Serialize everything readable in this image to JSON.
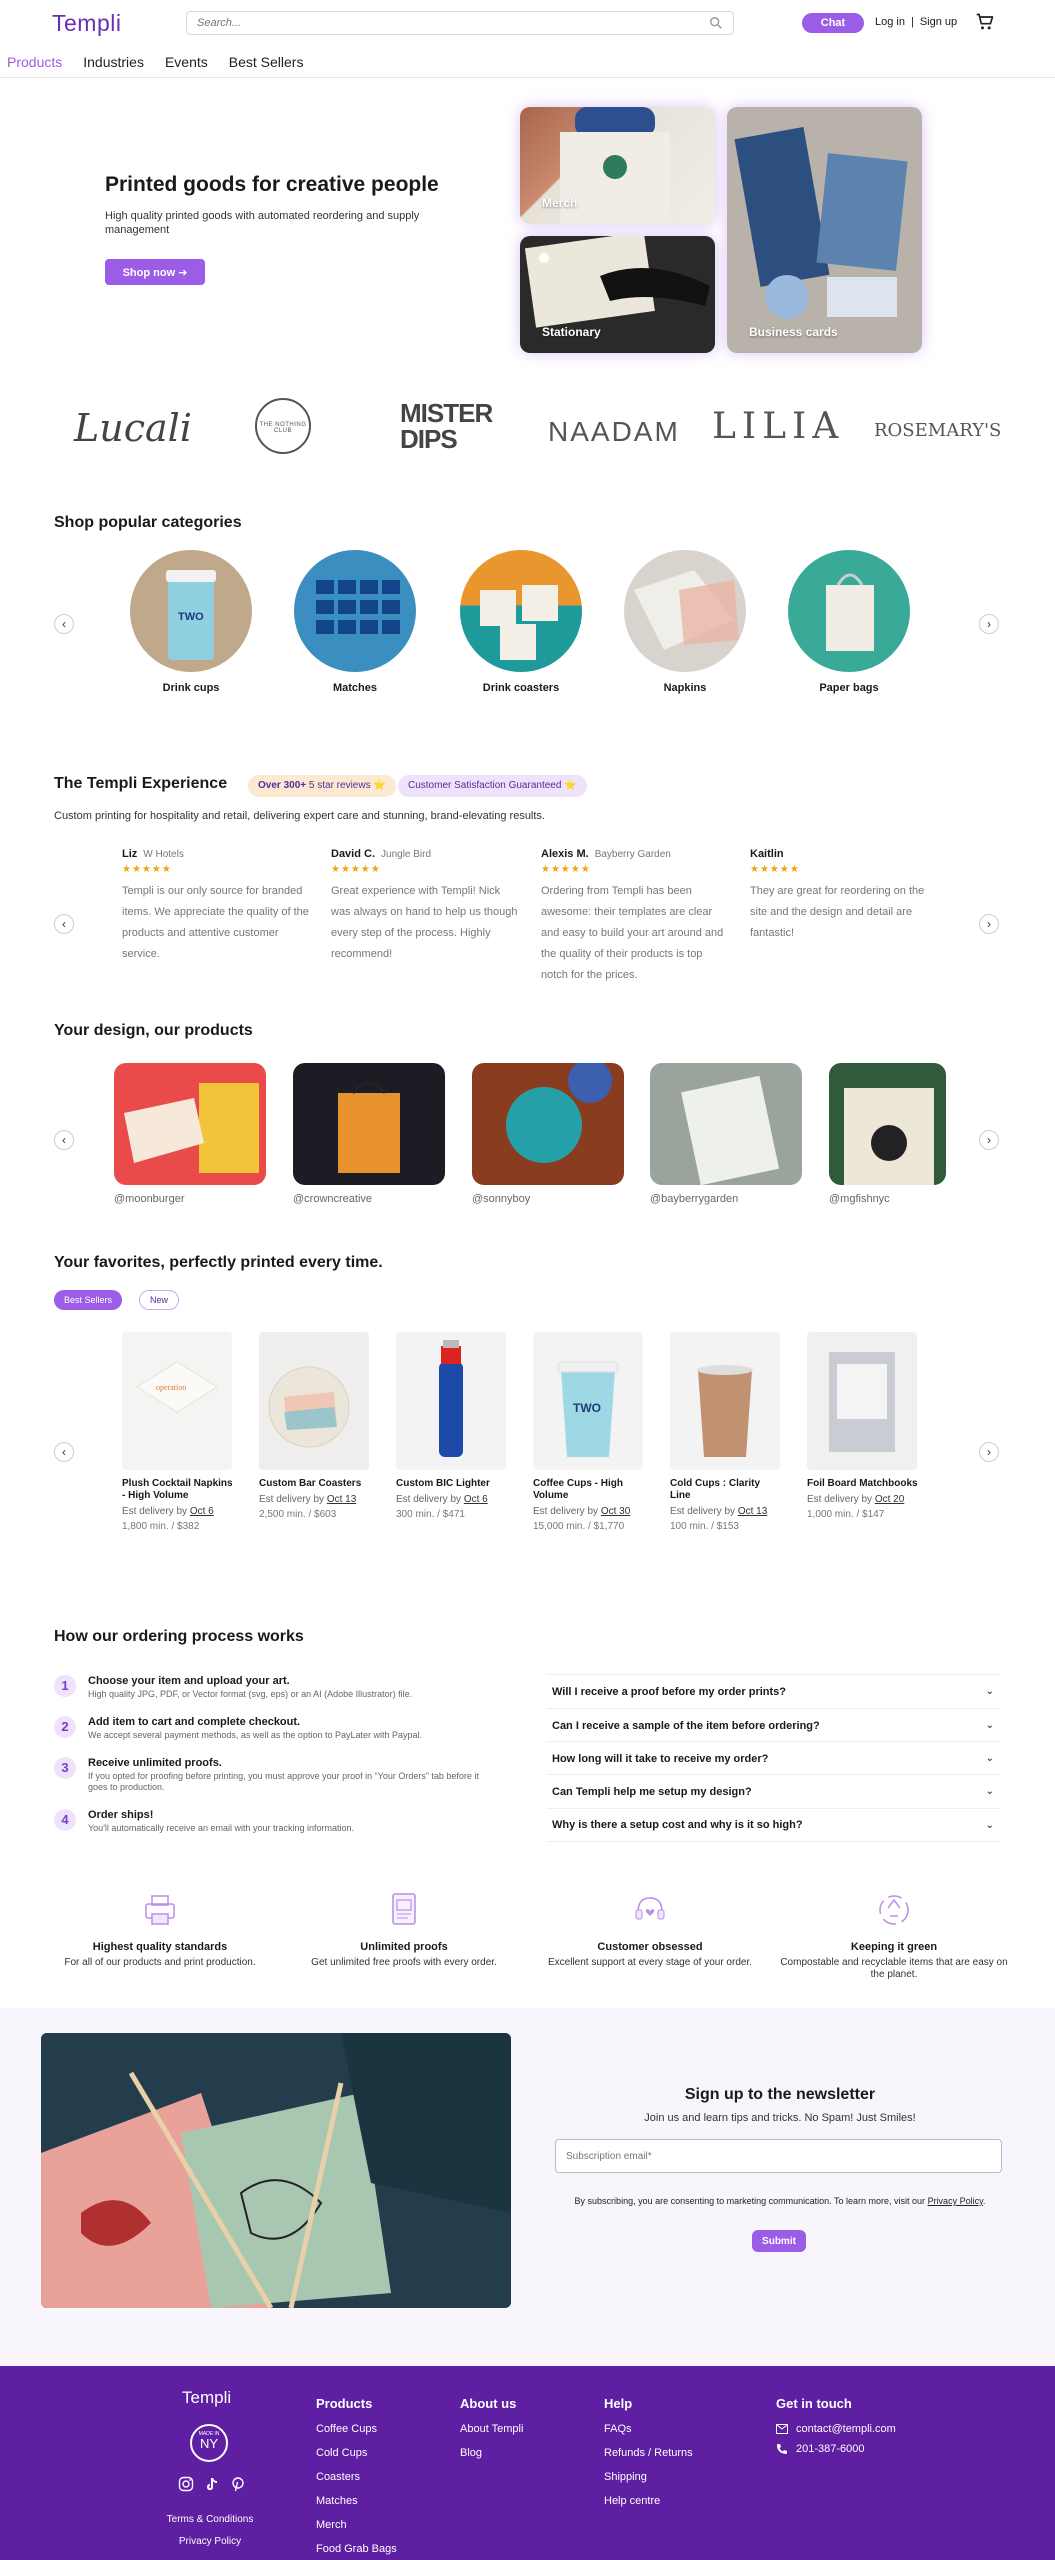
{
  "header": {
    "logo": "Templi",
    "search_placeholder": "Search...",
    "chat": "Chat",
    "login": "Log in",
    "separator": "|",
    "signup": "Sign up"
  },
  "nav": [
    "Products",
    "Industries",
    "Events",
    "Best Sellers"
  ],
  "hero": {
    "title": "Printed goods for creative people",
    "subtitle": "High quality printed goods with automated reordering and supply management",
    "cta": "Shop now",
    "tiles": [
      "Merch",
      "Stationary",
      "Business cards"
    ]
  },
  "brands": [
    "Lucali",
    "THE NOTHING CLUB",
    "MISTER DIPS",
    "NAADAM",
    "LILIA",
    "ROSEMARY'S"
  ],
  "categories": {
    "title": "Shop popular categories",
    "items": [
      "Drink cups",
      "Matches",
      "Drink coasters",
      "Napkins",
      "Paper bags"
    ]
  },
  "experience": {
    "title": "The Templi Experience",
    "pill1_bold": "Over 300+",
    "pill1_rest": "5 star reviews ⭐",
    "pill2": "Customer Satisfaction Guaranteed ⭐",
    "subtitle": "Custom printing for hospitality and retail, delivering expert care and stunning, brand-elevating results.",
    "reviews": [
      {
        "name": "Liz",
        "company": "W Hotels",
        "text": "Templi is our only source for branded items. We appreciate the quality of the products and attentive customer service."
      },
      {
        "name": "David C.",
        "company": "Jungle Bird",
        "text": "Great experience with Templi! Nick was always on hand to help us though every step of the process. Highly recommend!"
      },
      {
        "name": "Alexis M.",
        "company": "Bayberry Garden",
        "text": "Ordering from Templi has been awesome: their templates are clear and easy to build your art around and the quality of their products is top notch for the prices."
      },
      {
        "name": "Kaitlin",
        "company": "",
        "text": "They are great for reordering on the site and the design and detail are fantastic!"
      }
    ],
    "stars": "★★★★★"
  },
  "design": {
    "title": "Your design, our products",
    "handles": [
      "@moonburger",
      "@crowncreative",
      "@sonnyboy",
      "@bayberrygarden",
      "@mgfishnyc"
    ]
  },
  "favorites": {
    "title": "Your favorites, perfectly printed every time.",
    "tabs": [
      "Best Sellers",
      "New"
    ],
    "delivery_label": "Est delivery by",
    "products": [
      {
        "name": "Plush Cocktail Napkins - High Volume",
        "date": "Oct 6",
        "min": "1,800 min. / $382"
      },
      {
        "name": "Custom Bar Coasters",
        "date": "Oct 13",
        "min": "2,500 min. / $603"
      },
      {
        "name": "Custom BIC Lighter",
        "date": "Oct 6",
        "min": "300 min. / $471"
      },
      {
        "name": "Coffee Cups - High Volume",
        "date": "Oct 30",
        "min": "15,000 min. / $1,770"
      },
      {
        "name": "Cold Cups : Clarity Line",
        "date": "Oct 13",
        "min": "100 min. / $153"
      },
      {
        "name": "Foil Board Matchbooks",
        "date": "Oct 20",
        "min": "1,000 min. / $147"
      }
    ]
  },
  "process": {
    "title": "How our ordering process works",
    "steps": [
      {
        "n": "1",
        "title": "Choose your item and upload your art.",
        "desc": "High quality JPG, PDF, or Vector format (svg, eps) or an AI (Adobe Illustrator) file."
      },
      {
        "n": "2",
        "title": "Add item to cart and complete checkout.",
        "desc": "We accept several payment methods, as well as the option to PayLater with Paypal."
      },
      {
        "n": "3",
        "title": "Receive unlimited proofs.",
        "desc": "If you opted for proofing before printing, you must approve your proof in “Your Orders” tab before it goes to production."
      },
      {
        "n": "4",
        "title": "Order ships!",
        "desc": "You'll automatically receive an email with your tracking information."
      }
    ],
    "faqs": [
      "Will I receive a proof before my order prints?",
      "Can I receive a sample of the item before ordering?",
      "How long will it take to receive my order?",
      "Can Templi help me setup my design?",
      "Why is there a setup cost and why is it so high?"
    ]
  },
  "features": [
    {
      "title": "Highest quality standards",
      "desc": "For all of our products and print production."
    },
    {
      "title": "Unlimited proofs",
      "desc": "Get unlimited free proofs with every order."
    },
    {
      "title": "Customer obsessed",
      "desc": "Excellent support at every stage of your order."
    },
    {
      "title": "Keeping it green",
      "desc": "Compostable and recyclable items that are easy on the planet."
    }
  ],
  "newsletter": {
    "title": "Sign up to the newsletter",
    "subtitle": "Join us and learn tips and tricks. No Spam! Just Smiles!",
    "placeholder": "Subscription email*",
    "legal": "By subscribing, you are consenting to marketing communication. To learn more, visit our",
    "legal_link": "Privacy Policy",
    "legal_end": ".",
    "submit": "Submit"
  },
  "footer": {
    "logo": "Templi",
    "badge_top": "MADE IN",
    "badge_main": "NY",
    "terms": "Terms & Conditions",
    "privacy": "Privacy Policy",
    "products_title": "Products",
    "products": [
      "Coffee Cups",
      "Cold Cups",
      "Coasters",
      "Matches",
      "Merch",
      "Food Grab Bags"
    ],
    "about_title": "About us",
    "about": [
      "About Templi",
      "Blog"
    ],
    "help_title": "Help",
    "help": [
      "FAQs",
      "Refunds / Returns",
      "Shipping",
      "Help centre"
    ],
    "contact_title": "Get in touch",
    "email": "contact@templi.com",
    "phone": "201-387-6000"
  },
  "colors": {
    "accent": "#9b5de5",
    "footer": "#5f1fa2",
    "brand_text": "#6b2fb3",
    "star": "#f0a30a"
  }
}
